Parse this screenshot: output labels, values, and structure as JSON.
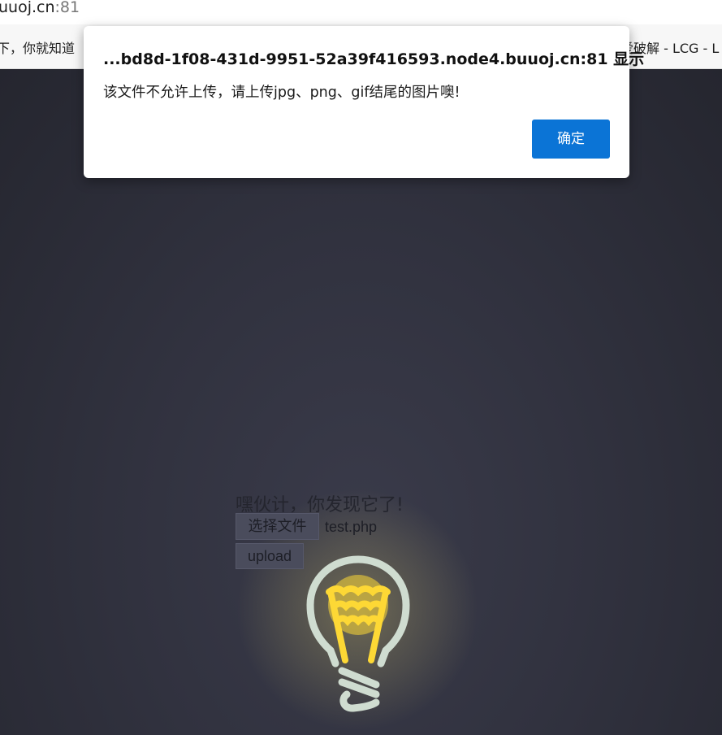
{
  "browser": {
    "url_host": "uuoj.cn",
    "url_port": ":81",
    "bookmarks": {
      "left_label": "下，你就知道",
      "right_label": "爱破解 - LCG - L"
    }
  },
  "page": {
    "heading": "嘿伙计，你发现它了!",
    "choose_file_label": "选择文件",
    "file_name": "test.php",
    "upload_label": "upload",
    "bulb_colors": {
      "outline": "#cfdcd0",
      "filament": "#fdd835",
      "glow": "#fff07a"
    }
  },
  "dialog": {
    "title": "...bd8d-1f08-431d-9951-52a39f416593.node4.buuoj.cn:81 显示",
    "message": "该文件不允许上传，请上传jpg、png、gif结尾的图片噢!",
    "ok_label": "确定",
    "accent": "#0b74d6"
  }
}
